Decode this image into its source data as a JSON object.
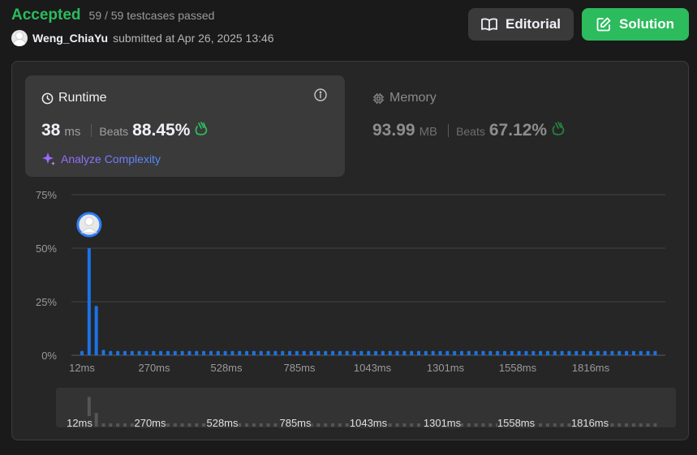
{
  "status": {
    "title": "Accepted",
    "testcases": "59 / 59 testcases passed"
  },
  "submission": {
    "username": "Weng_ChiaYu",
    "submitted_text": "submitted at Apr 26, 2025 13:46"
  },
  "buttons": {
    "editorial": "Editorial",
    "solution": "Solution"
  },
  "runtime": {
    "label": "Runtime",
    "value": "38",
    "unit": "ms",
    "beats_label": "Beats",
    "beats": "88.45%",
    "analyze": "Analyze Complexity"
  },
  "memory": {
    "label": "Memory",
    "value": "93.99",
    "unit": "MB",
    "beats_label": "Beats",
    "beats": "67.12%"
  },
  "colors": {
    "accent_green": "#2cbb5d",
    "bar_blue": "#1a73e8",
    "bar_gray": "#555555",
    "memory_gray": "#8d8d8d"
  },
  "chart_data": {
    "type": "bar",
    "ylabel_ticks": [
      "0%",
      "25%",
      "50%",
      "75%"
    ],
    "ylim": [
      0,
      75
    ],
    "x_tick_labels": [
      "12ms",
      "270ms",
      "528ms",
      "785ms",
      "1043ms",
      "1301ms",
      "1558ms",
      "1816ms"
    ],
    "bar_count": 81,
    "values": [
      2,
      50,
      23,
      2.5,
      2,
      2,
      2,
      2,
      2,
      2,
      2,
      2,
      2,
      2,
      2,
      2,
      2,
      2,
      2,
      2,
      2,
      2,
      2,
      2,
      2,
      2,
      2,
      2,
      2,
      2,
      2,
      2,
      2,
      2,
      2,
      2,
      2,
      2,
      2,
      2,
      2,
      2,
      2,
      2,
      2,
      2,
      2,
      2,
      2,
      2,
      2,
      2,
      2,
      2,
      2,
      2,
      2,
      2,
      2,
      2,
      2,
      2,
      2,
      2,
      2,
      2,
      2,
      2,
      2,
      2,
      2,
      2,
      2,
      2,
      2,
      2,
      2,
      2,
      2,
      2,
      2
    ],
    "highlight_index": 1,
    "grid": true
  }
}
